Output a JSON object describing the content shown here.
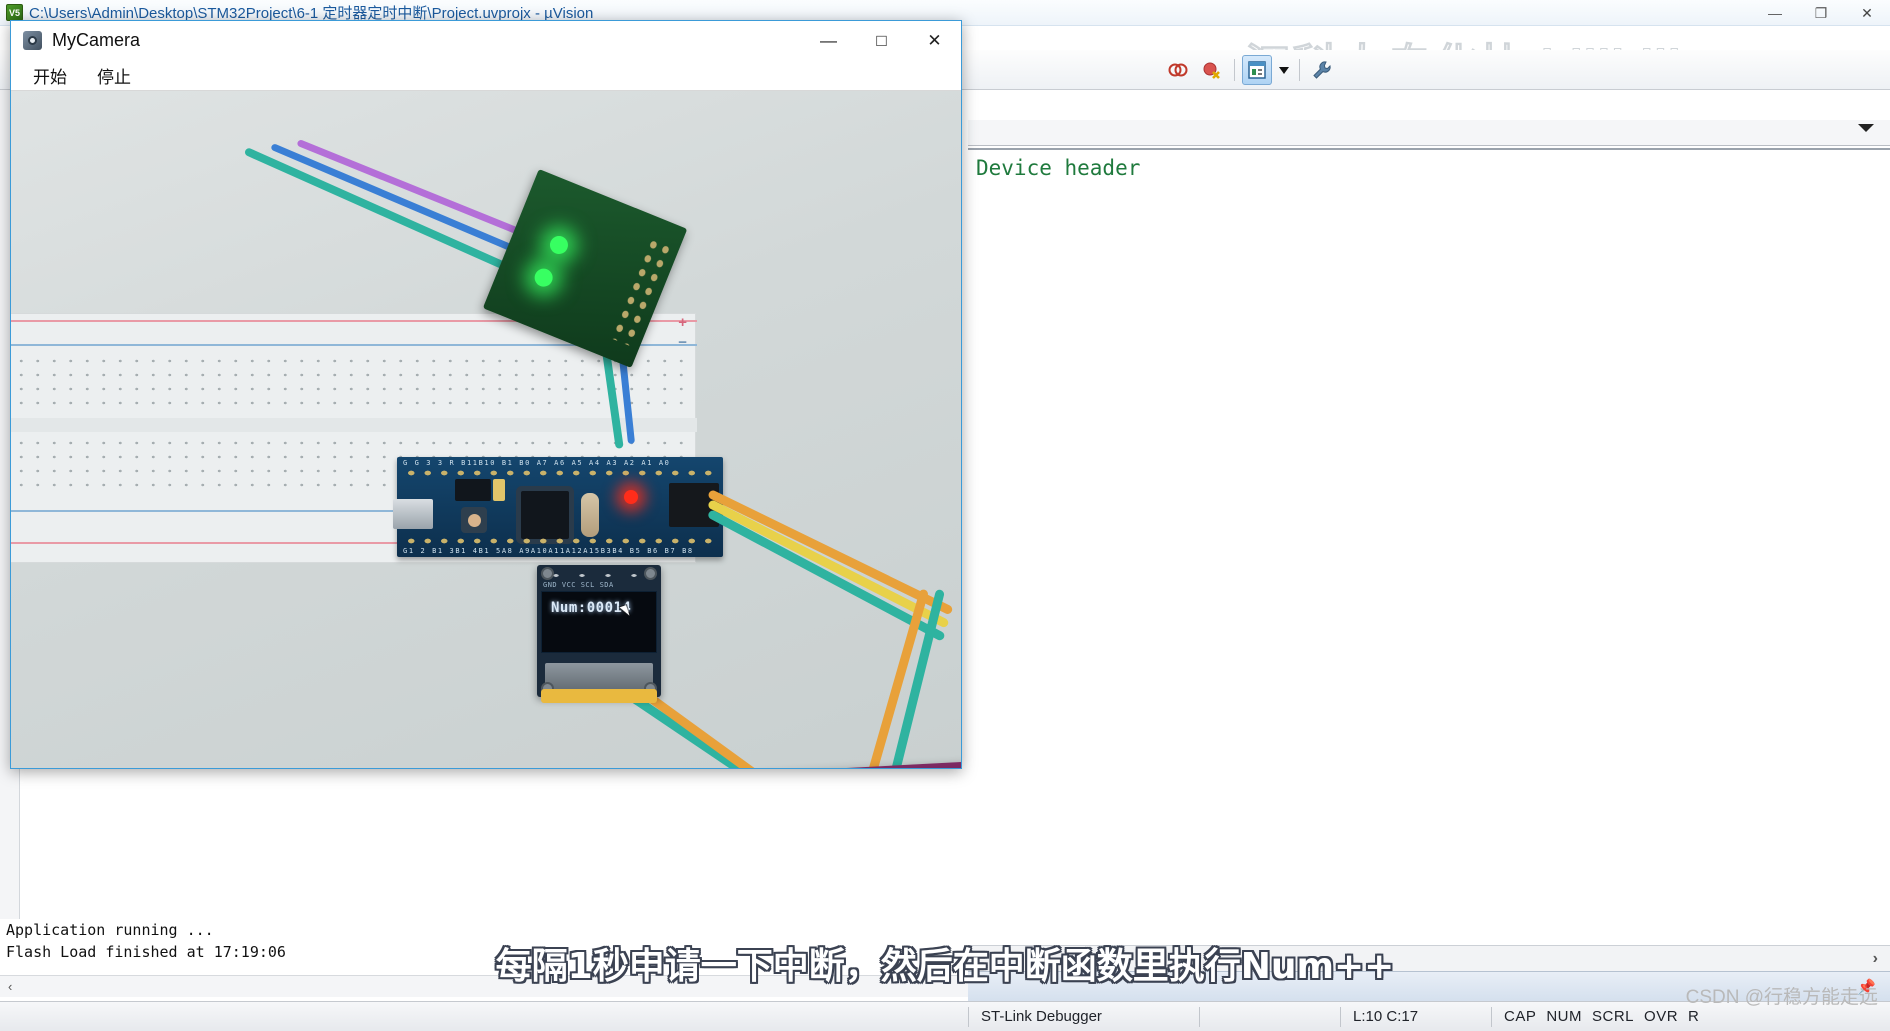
{
  "uvision": {
    "title": "C:\\Users\\Admin\\Desktop\\STM32Project\\6-1 定时器定时中断\\Project.uvprojx - µVision",
    "app_icon": "uvision-icon",
    "window_buttons": {
      "minimize": "—",
      "maximize": "❐",
      "close": "✕"
    },
    "toolbar": {
      "items": [
        {
          "name": "breakpoints-icon",
          "glyph": "◎◎"
        },
        {
          "name": "kill-all-breakpoints-icon",
          "glyph": "◉✖"
        },
        {
          "name": "memory-window-icon",
          "glyph": "▤"
        },
        {
          "name": "memory-window-dropdown-icon",
          "glyph": "▾"
        },
        {
          "name": "configuration-wrench-icon",
          "glyph": "🔧"
        }
      ]
    },
    "editor": {
      "code_line": "Device header",
      "tabs_chevron_icon": "chevron-down-icon",
      "hscroll_right_icon": "›",
      "pin_icon": "pin-icon"
    },
    "output": {
      "lines": [
        "Application running ...",
        "Flash Load finished at 17:19:06"
      ],
      "scroll_left_icon": "‹"
    },
    "statusbar": {
      "debugger": "ST-Link Debugger",
      "blank": "",
      "position": "L:10 C:17",
      "flags": [
        "CAP",
        "NUM",
        "SCRL",
        "OVR",
        "R"
      ]
    }
  },
  "camera_window": {
    "title": "MyCamera",
    "icon": "camera-icon",
    "menu": [
      {
        "name": "start-button",
        "label": "开始"
      },
      {
        "name": "stop-button",
        "label": "停止"
      }
    ],
    "window_buttons": {
      "minimize": "—",
      "maximize": "□",
      "close": "✕"
    },
    "scene": {
      "oled_text": "Num:00014",
      "oled_silk": "GND VCC SCL SDA",
      "stm32_silk_top": "G  G 3 3  R  B11B10 B1 B0 A7 A6 A5 A4 A3 A2 A1 A0",
      "stm32_silk_bottom": "G1 2 B1 3B1 4B1 5A8 A9A10A11A12A15B3B4 B5  B6  B7 B8",
      "cursor": "mouse-pointer"
    }
  },
  "subtitle": "每隔1秒申请一下中断，然后在中断函数里执行Num++",
  "watermarks": {
    "bilibili": "江科大自化协 bilibili",
    "csdn": "CSDN @行稳方能走远"
  },
  "colors": {
    "title_text": "#1b5a9e",
    "code_green": "#1f7a3d",
    "accent_blue": "#3b9bd8",
    "led_red": "#ff2d1a",
    "led_green": "#38ff62"
  }
}
